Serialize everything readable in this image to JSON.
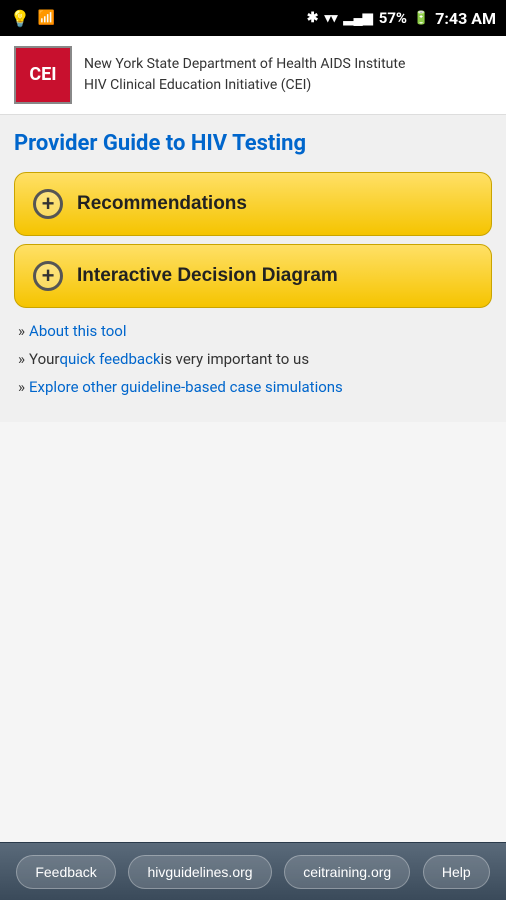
{
  "statusBar": {
    "time": "7:43 AM",
    "battery": "57%",
    "icons": {
      "wifi": "wifi-icon",
      "bluetooth": "bt-icon",
      "signal": "signal-bars"
    }
  },
  "header": {
    "logoText": "CEI",
    "orgLine1": "New York State Department of Health AIDS Institute",
    "orgLine2": "HIV Clinical Education Initiative (CEI)"
  },
  "pageTitle": "Provider Guide to HIV Testing",
  "buttons": [
    {
      "id": "recommendations",
      "label": "Recommendations"
    },
    {
      "id": "interactive-decision-diagram",
      "label": "Interactive Decision Diagram"
    }
  ],
  "links": [
    {
      "id": "about",
      "prefix": "»",
      "linkText": "About this tool",
      "href": "#",
      "suffix": ""
    },
    {
      "id": "feedback",
      "prefix": "»",
      "preText": "Your ",
      "linkText": "quick feedback",
      "href": "#",
      "suffix": " is very important to us"
    },
    {
      "id": "explore",
      "prefix": "»",
      "linkText": "Explore other guideline-based case simulations",
      "href": "#",
      "suffix": ""
    }
  ],
  "bottomNav": {
    "buttons": [
      {
        "id": "feedback-btn",
        "label": "Feedback"
      },
      {
        "id": "hivguidelines-btn",
        "label": "hivguidelines.org"
      },
      {
        "id": "ceitraining-btn",
        "label": "ceitraining.org"
      },
      {
        "id": "help-btn",
        "label": "Help"
      }
    ]
  }
}
